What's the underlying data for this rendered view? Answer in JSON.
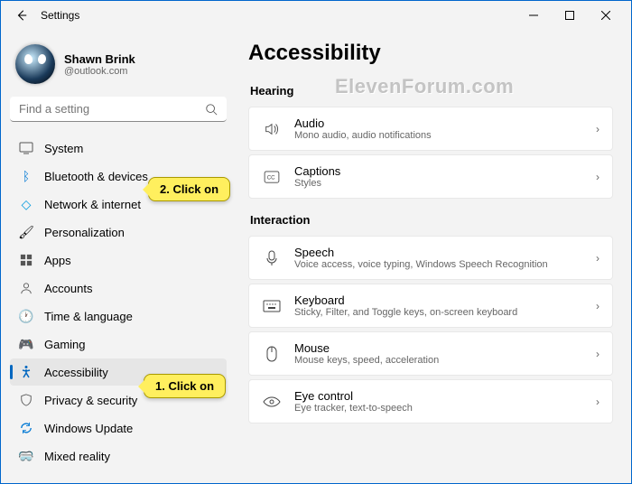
{
  "window": {
    "title": "Settings"
  },
  "profile": {
    "name": "Shawn Brink",
    "email": "@outlook.com"
  },
  "search": {
    "placeholder": "Find a setting"
  },
  "sidebar": {
    "items": [
      {
        "label": "System"
      },
      {
        "label": "Bluetooth & devices"
      },
      {
        "label": "Network & internet"
      },
      {
        "label": "Personalization"
      },
      {
        "label": "Apps"
      },
      {
        "label": "Accounts"
      },
      {
        "label": "Time & language"
      },
      {
        "label": "Gaming"
      },
      {
        "label": "Accessibility"
      },
      {
        "label": "Privacy & security"
      },
      {
        "label": "Windows Update"
      },
      {
        "label": "Mixed reality"
      }
    ]
  },
  "page": {
    "title": "Accessibility"
  },
  "sections": {
    "hearing": {
      "title": "Hearing",
      "audio": {
        "title": "Audio",
        "sub": "Mono audio, audio notifications"
      },
      "captions": {
        "title": "Captions",
        "sub": "Styles"
      }
    },
    "interaction": {
      "title": "Interaction",
      "speech": {
        "title": "Speech",
        "sub": "Voice access, voice typing, Windows Speech Recognition"
      },
      "keyboard": {
        "title": "Keyboard",
        "sub": "Sticky, Filter, and Toggle keys, on-screen keyboard"
      },
      "mouse": {
        "title": "Mouse",
        "sub": "Mouse keys, speed, acceleration"
      },
      "eye": {
        "title": "Eye control",
        "sub": "Eye tracker, text-to-speech"
      }
    }
  },
  "callouts": {
    "one": "1. Click on",
    "two": "2. Click on"
  },
  "watermark": "ElevenForum.com"
}
